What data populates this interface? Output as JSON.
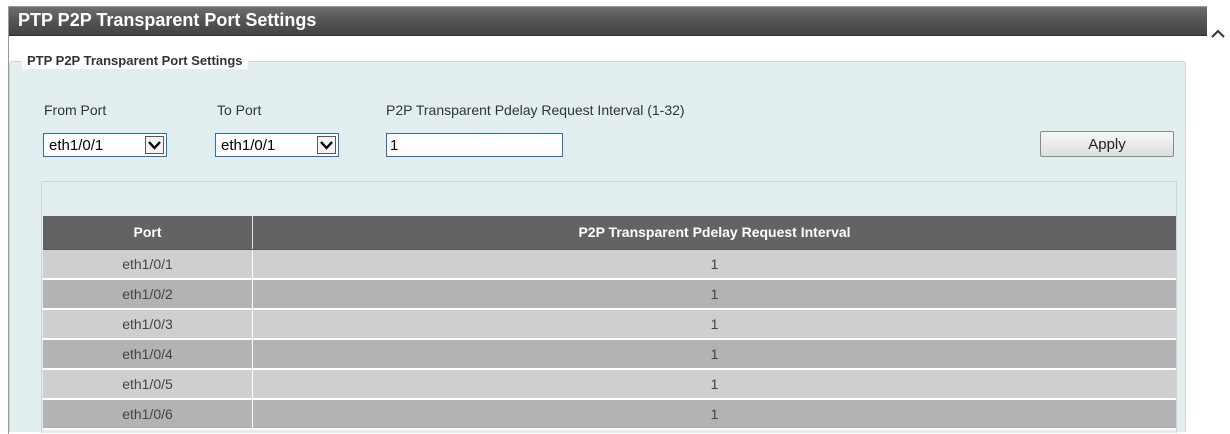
{
  "page": {
    "title": "PTP P2P Transparent Port Settings"
  },
  "section": {
    "legend": "PTP P2P Transparent Port Settings"
  },
  "form": {
    "from_port_label": "From Port",
    "from_port_value": "eth1/0/1",
    "to_port_label": "To Port",
    "to_port_value": "eth1/0/1",
    "interval_label": "P2P Transparent Pdelay Request Interval (1-32)",
    "interval_value": "1",
    "apply_label": "Apply"
  },
  "table": {
    "columns": [
      "Port",
      "P2P Transparent Pdelay Request Interval"
    ],
    "rows": [
      {
        "port": "eth1/0/1",
        "interval": "1"
      },
      {
        "port": "eth1/0/2",
        "interval": "1"
      },
      {
        "port": "eth1/0/3",
        "interval": "1"
      },
      {
        "port": "eth1/0/4",
        "interval": "1"
      },
      {
        "port": "eth1/0/5",
        "interval": "1"
      },
      {
        "port": "eth1/0/6",
        "interval": "1"
      }
    ]
  },
  "icons": {
    "scroll_up": "chevron-up-icon",
    "dropdown": "chevron-down-icon"
  },
  "colors": {
    "title_bar": "#565656",
    "panel_background": "#e3eeee",
    "table_header": "#636363",
    "row_dark": "#b3b3b3",
    "row_light": "#cfcfcf",
    "input_border": "#2f6ea8"
  }
}
